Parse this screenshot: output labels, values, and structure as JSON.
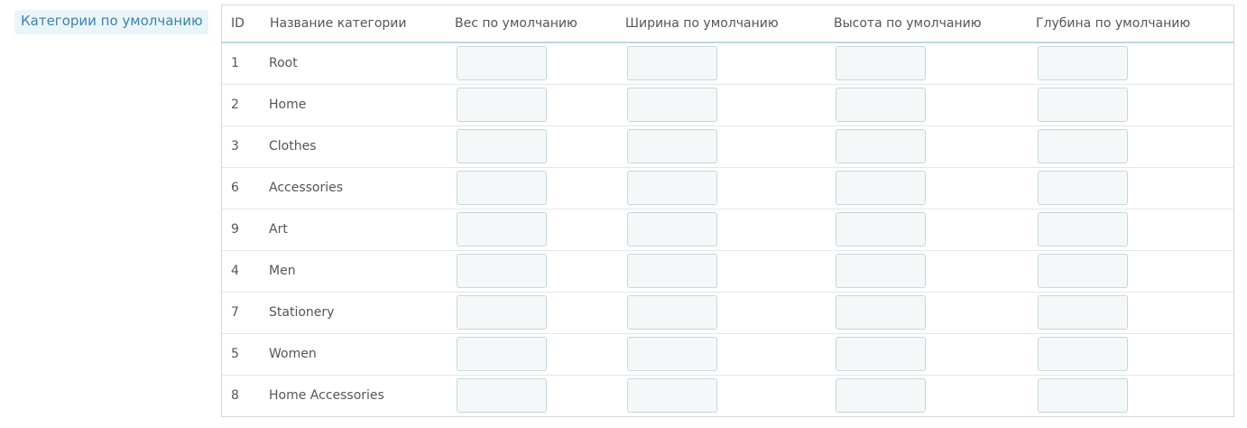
{
  "section": {
    "label": "Категории по умолчанию"
  },
  "table": {
    "headers": {
      "id": "ID",
      "name": "Название категории",
      "weight": "Вес по умолчанию",
      "width": "Ширина по умолчанию",
      "height": "Высота по умолчанию",
      "depth": "Глубина по умолчанию"
    },
    "rows": [
      {
        "id": "1",
        "name": "Root",
        "weight": "",
        "width": "",
        "height": "",
        "depth": ""
      },
      {
        "id": "2",
        "name": "Home",
        "weight": "",
        "width": "",
        "height": "",
        "depth": ""
      },
      {
        "id": "3",
        "name": "Clothes",
        "weight": "",
        "width": "",
        "height": "",
        "depth": ""
      },
      {
        "id": "6",
        "name": "Accessories",
        "weight": "",
        "width": "",
        "height": "",
        "depth": ""
      },
      {
        "id": "9",
        "name": "Art",
        "weight": "",
        "width": "",
        "height": "",
        "depth": ""
      },
      {
        "id": "4",
        "name": "Men",
        "weight": "",
        "width": "",
        "height": "",
        "depth": ""
      },
      {
        "id": "7",
        "name": "Stationery",
        "weight": "",
        "width": "",
        "height": "",
        "depth": ""
      },
      {
        "id": "5",
        "name": "Women",
        "weight": "",
        "width": "",
        "height": "",
        "depth": ""
      },
      {
        "id": "8",
        "name": "Home Accessories",
        "weight": "",
        "width": "",
        "height": "",
        "depth": ""
      }
    ]
  },
  "colors": {
    "label_text": "#3c83a6",
    "label_bg": "#eaf5fa",
    "header_border": "#bcd7e4",
    "input_bg": "#f5f8f9",
    "input_border": "#c7d6db"
  }
}
